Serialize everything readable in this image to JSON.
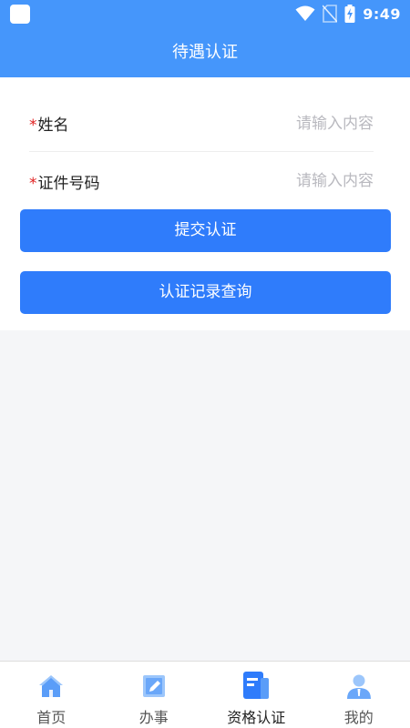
{
  "status_bar": {
    "time": "9:49"
  },
  "header": {
    "title": "待遇认证"
  },
  "form": {
    "required_mark": "*",
    "fields": [
      {
        "label": "姓名",
        "placeholder": "请输入内容",
        "value": ""
      },
      {
        "label": "证件号码",
        "placeholder": "请输入内容",
        "value": ""
      }
    ]
  },
  "buttons": {
    "submit": "提交认证",
    "query": "认证记录查询"
  },
  "tabbar": {
    "items": [
      {
        "label": "首页",
        "icon": "home-icon"
      },
      {
        "label": "办事",
        "icon": "edit-icon"
      },
      {
        "label": "资格认证",
        "icon": "document-icon",
        "active": true
      },
      {
        "label": "我的",
        "icon": "user-icon"
      }
    ]
  },
  "colors": {
    "header": "#4596fb",
    "button": "#2f7cfb",
    "required": "#e02020"
  }
}
